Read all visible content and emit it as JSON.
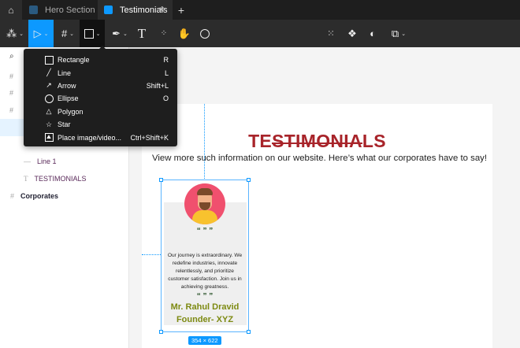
{
  "tabs": [
    {
      "label": "Hero Section",
      "active": false
    },
    {
      "label": "Testimonials",
      "active": true
    }
  ],
  "tab_add": "+",
  "tab_close": "✕",
  "shape_menu": {
    "items": [
      {
        "icon": "rectangle-icon",
        "label": "Rectangle",
        "shortcut": "R"
      },
      {
        "icon": "line-icon",
        "label": "Line",
        "shortcut": "L"
      },
      {
        "icon": "arrow-icon",
        "label": "Arrow",
        "shortcut": "Shift+L"
      },
      {
        "icon": "ellipse-icon",
        "label": "Ellipse",
        "shortcut": "O"
      },
      {
        "icon": "polygon-icon",
        "label": "Polygon",
        "shortcut": ""
      },
      {
        "icon": "star-icon",
        "label": "Star",
        "shortcut": ""
      },
      {
        "icon": "image-icon",
        "label": "Place image/video...",
        "shortcut": "Ctrl+Shift+K"
      }
    ]
  },
  "layers": {
    "line": "Line 1",
    "text": "TESTIMONIALS",
    "frame": "Corporates"
  },
  "canvas": {
    "title": "TESTIMONIALS",
    "subtitle": "View more such information on our website. Here’s what our corporates have to say!",
    "card": {
      "quote_marks": "“ ” ”",
      "body": "Our journey is extraordinary. We redefine industries, innovate relentlessly, and prioritize customer satisfaction. Join us in achieving greatness.",
      "name": "Mr. Rahul Dravid",
      "role": "Founder- XYZ"
    },
    "selection_size": "354 × 622"
  },
  "colors": {
    "accent": "#0d99ff",
    "title": "#a8242a",
    "name": "#7d8a12"
  }
}
